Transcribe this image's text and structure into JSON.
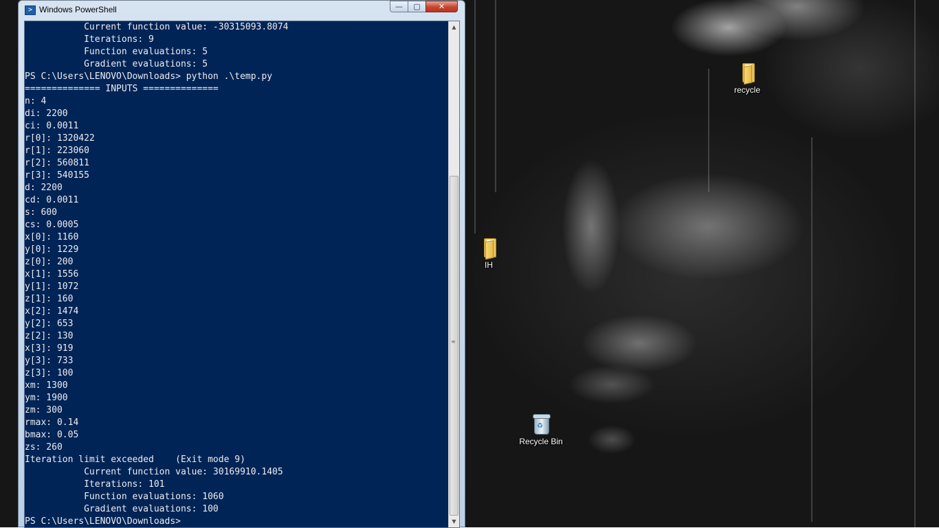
{
  "window": {
    "title": "Windows PowerShell",
    "icon": "powershell-icon",
    "controls": {
      "minimize": "minimize-icon",
      "maximize": "maximize-icon",
      "close": "close-icon"
    }
  },
  "console": {
    "background": "#012456",
    "foreground": "#eeedf0",
    "lines": [
      "           Current function value: -30315093.8074",
      "           Iterations: 9",
      "           Function evaluations: 5",
      "           Gradient evaluations: 5",
      "PS C:\\Users\\LENOVO\\Downloads> python .\\temp.py",
      "============== INPUTS ==============",
      "n: 4",
      "di: 2200",
      "ci: 0.0011",
      "r[0]: 1320422",
      "r[1]: 223060",
      "r[2]: 560811",
      "r[3]: 540155",
      "d: 2200",
      "cd: 0.0011",
      "s: 600",
      "cs: 0.0005",
      "x[0]: 1160",
      "y[0]: 1229",
      "z[0]: 200",
      "x[1]: 1556",
      "y[1]: 1072",
      "z[1]: 160",
      "x[2]: 1474",
      "y[2]: 653",
      "z[2]: 130",
      "x[3]: 919",
      "y[3]: 733",
      "z[3]: 100",
      "xm: 1300",
      "ym: 1900",
      "zm: 300",
      "rmax: 0.14",
      "bmax: 0.05",
      "zs: 260",
      "Iteration limit exceeded    (Exit mode 9)",
      "           Current function value: 30169910.1405",
      "           Iterations: 101",
      "           Function evaluations: 1060",
      "           Gradient evaluations: 100",
      "PS C:\\Users\\LENOVO\\Downloads>"
    ]
  },
  "desktop": {
    "icons": [
      {
        "label": "recycle",
        "icon": "folder-icon"
      },
      {
        "label": "IH",
        "icon": "folder-icon"
      },
      {
        "label": "Recycle Bin",
        "icon": "recycle-bin-icon"
      }
    ]
  }
}
